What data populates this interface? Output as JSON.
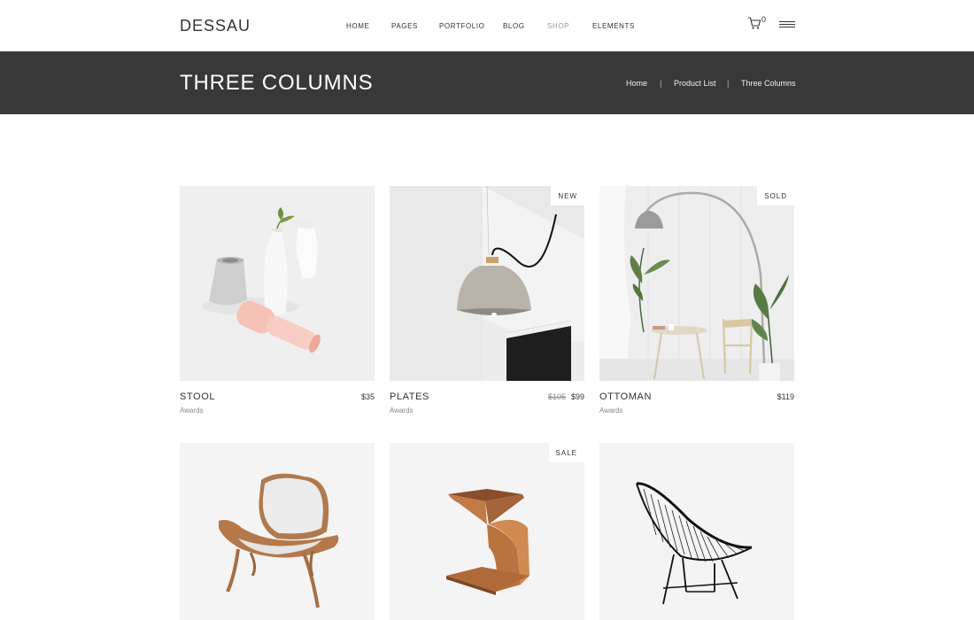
{
  "brand": {
    "logo": "DESSAU"
  },
  "nav": {
    "items": [
      {
        "label": "HOME"
      },
      {
        "label": "PAGES"
      },
      {
        "label": "PORTFOLIO"
      },
      {
        "label": "BLOG"
      },
      {
        "label": "SHOP",
        "active": true
      },
      {
        "label": "ELEMENTS"
      }
    ],
    "cart_count": "0",
    "cart_icon": "cart-icon",
    "menu_icon": "hamburger-menu-icon"
  },
  "titlebar": {
    "title": "THREE COLUMNS",
    "breadcrumb": [
      "Home",
      "Product List",
      "Three Columns"
    ],
    "separator": "|",
    "background": "#383838"
  },
  "products": [
    {
      "name": "STOOL",
      "category": "Awards",
      "price": "$35",
      "badge": ""
    },
    {
      "name": "PLATES",
      "category": "Awards",
      "old_price": "$105",
      "price": "$99",
      "badge": "NEW"
    },
    {
      "name": "OTTOMAN",
      "category": "Awards",
      "price": "$119",
      "badge": "SOLD"
    },
    {
      "name": "",
      "category": "",
      "price": "",
      "badge": ""
    },
    {
      "name": "",
      "category": "",
      "price": "",
      "badge": "SALE"
    },
    {
      "name": "",
      "category": "",
      "price": "",
      "badge": ""
    }
  ]
}
